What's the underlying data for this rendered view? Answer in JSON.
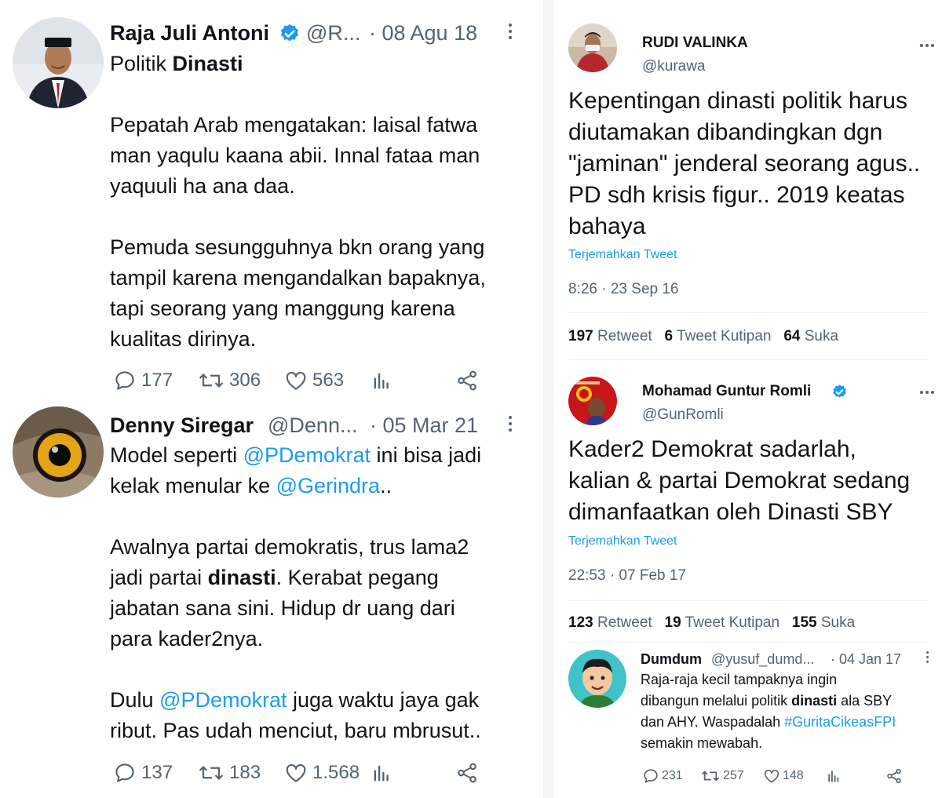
{
  "colors": {
    "link": "#1d9bf0",
    "text": "#0f1419",
    "secondary": "#536471",
    "verified": "#1d9bf0"
  },
  "left": {
    "tweet1": {
      "name": "Raja Juli Antoni",
      "handle": "@R...",
      "date": "· 08 Agu 18",
      "title": {
        "pre": "Politik ",
        "bold": "Dinasti"
      },
      "lines": [
        "Pepatah Arab mengatakan: laisal fatwa",
        "man yaqulu kaana abii. Innal fataa man",
        "yaquuli ha ana daa.",
        "Pemuda sesungguhnya bkn orang yang",
        "tampil karena mengandalkan bapaknya,",
        "tapi seorang yang manggung karena",
        "kualitas dirinya."
      ],
      "replies": "177",
      "retweets": "306",
      "likes": "563",
      "icons": [
        "reply-icon",
        "retweet-icon",
        "like-icon",
        "analytics-icon",
        "share-icon",
        "more-icon",
        "verified-icon"
      ]
    },
    "tweet2": {
      "name": "Denny Siregar",
      "handle": "@Denn...",
      "date": "· 05 Mar 21",
      "line1": {
        "pre": "Model seperti ",
        "mention": "@PDemokrat",
        "post": " ini bisa jadi"
      },
      "line2": {
        "pre": "kelak menular ke ",
        "mention": "@Gerindra",
        "post": ".."
      },
      "line3": "Awalnya partai demokratis, trus lama2",
      "line4": {
        "pre": "jadi partai ",
        "bold": "dinasti",
        "post": ". Kerabat pegang"
      },
      "line5": "jabatan sana sini. Hidup dr uang dari",
      "line6": "para kader2nya.",
      "line7": {
        "pre": "Dulu ",
        "mention": "@PDemokrat",
        "post": " juga waktu jaya gak"
      },
      "line8": "ribut. Pas udah menciut, baru mbrusut..",
      "replies": "137",
      "retweets": "183",
      "likes": "1.568"
    }
  },
  "right": {
    "tweet3": {
      "name": "RUDI VALINKA",
      "handle": "@kurawa",
      "lines": [
        "Kepentingan dinasti politik harus",
        "diutamakan dibandingkan dgn",
        "\"jaminan\" jenderal seorang agus..",
        "PD sdh krisis figur.. 2019 keatas",
        "bahaya"
      ],
      "translate": "Terjemahkan Tweet",
      "time": "8:26 · 23 Sep 16",
      "retweet_count": "197",
      "retweet_label": "Retweet",
      "quote_count": "6",
      "quote_label": "Tweet Kutipan",
      "like_count": "64",
      "like_label": "Suka"
    },
    "tweet4": {
      "name": "Mohamad Guntur Romli",
      "handle": "@GunRomli",
      "lines": [
        "Kader2 Demokrat sadarlah,",
        "kalian & partai Demokrat sedang",
        "dimanfaatkan oleh Dinasti SBY"
      ],
      "translate": "Terjemahkan Tweet",
      "time": "22:53 · 07 Feb 17",
      "retweet_count": "123",
      "retweet_label": "Retweet",
      "quote_count": "19",
      "quote_label": "Tweet Kutipan",
      "like_count": "155",
      "like_label": "Suka"
    },
    "tweet5": {
      "name": "Dumdum",
      "handle": "@yusuf_dumd...",
      "date": "· 04 Jan 17",
      "line1": "Raja-raja kecil tampaknya ingin",
      "line2": {
        "pre": "dibangun melalui politik ",
        "bold": "dinasti",
        "post": " ala SBY"
      },
      "line3": {
        "pre": "dan AHY. Waspadalah ",
        "hashtag": "#GuritaCikeasFPI"
      },
      "line4": "semakin mewabah.",
      "replies": "231",
      "retweets": "257",
      "likes": "148"
    }
  }
}
